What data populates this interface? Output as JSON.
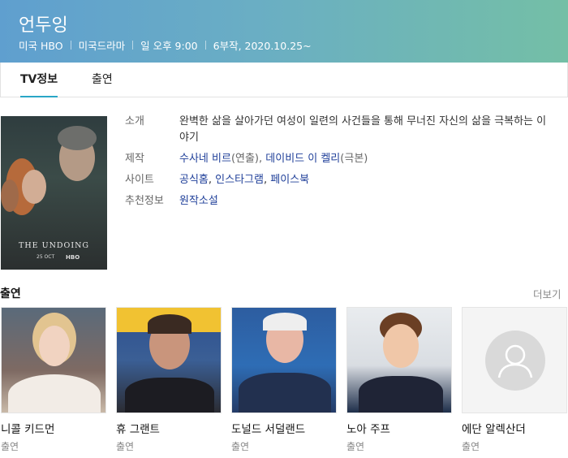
{
  "header": {
    "title": "언두잉",
    "meta": [
      "미국 HBO",
      "미국드라마",
      "일 오후 9:00",
      "6부작, 2020.10.25~"
    ]
  },
  "tabs": [
    {
      "label": "TV정보",
      "active": true
    },
    {
      "label": "출연",
      "active": false
    }
  ],
  "poster": {
    "title": "THE UNDOING",
    "date": "25 OCT",
    "network": "HBO"
  },
  "info": {
    "intro_label": "소개",
    "intro_text": "완벽한 삶을 살아가던 여성이 일련의 사건들을 통해 무너진 자신의 삶을 극복하는 이야기",
    "production_label": "제작",
    "production": [
      {
        "name": "수사네 비르",
        "role": "(연출)"
      },
      {
        "name": "데이비드 이 켈리",
        "role": "(극본)"
      }
    ],
    "site_label": "사이트",
    "sites": [
      "공식홈",
      "인스타그램",
      "페이스북"
    ],
    "recommend_label": "추천정보",
    "recommend": "원작소설"
  },
  "cast": {
    "heading": "출연",
    "more_label": "더보기",
    "members": [
      {
        "name": "니콜 키드먼",
        "role": "출연"
      },
      {
        "name": "휴 그랜트",
        "role": "출연"
      },
      {
        "name": "도널드 서덜랜드",
        "role": "출연"
      },
      {
        "name": "노아 주프",
        "role": "출연"
      },
      {
        "name": "에단 알렉산더",
        "role": "출연"
      }
    ]
  },
  "colors": {
    "header_start": "#5f9fcf",
    "header_end": "#74bfa6",
    "link": "#1f3f99",
    "tab_underline": "#2aa6c6"
  }
}
